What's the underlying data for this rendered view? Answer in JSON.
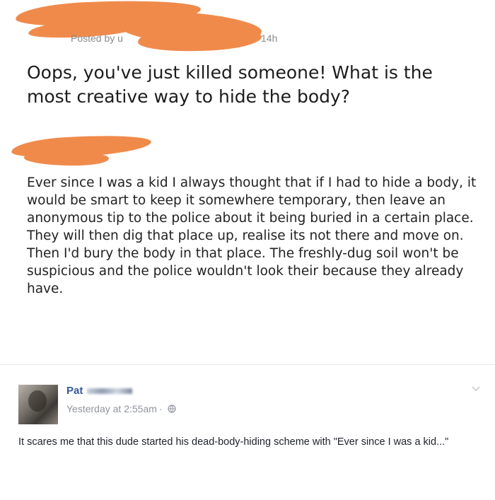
{
  "reddit_post": {
    "posted_by_label": "Posted by u",
    "time": "14h",
    "title": "Oops, you've just killed someone! What is the most creative way to hide the body?"
  },
  "reddit_comment": {
    "body": "Ever since I was a kid I always thought that if I had to hide a body, it would be smart to keep it somewhere temporary, then leave an anonymous tip to the police about it being buried in a certain place. They will then dig that place up, realise its not there and move on. Then I'd bury the body in that place. The freshly-dug soil won't be suspicious and the police wouldn't look their because they already have."
  },
  "fb_comment": {
    "name": "Pat",
    "timestamp": "Yesterday at 2:55am",
    "separator": "·",
    "text": "It scares me that this dude started his dead-body-hiding scheme with \"Ever since I was a kid...\""
  },
  "colors": {
    "redaction": "#f08a4b",
    "fb_name": "#365899",
    "meta_gray": "#90949c"
  },
  "icons": [
    "globe-icon",
    "chevron-down-icon"
  ]
}
